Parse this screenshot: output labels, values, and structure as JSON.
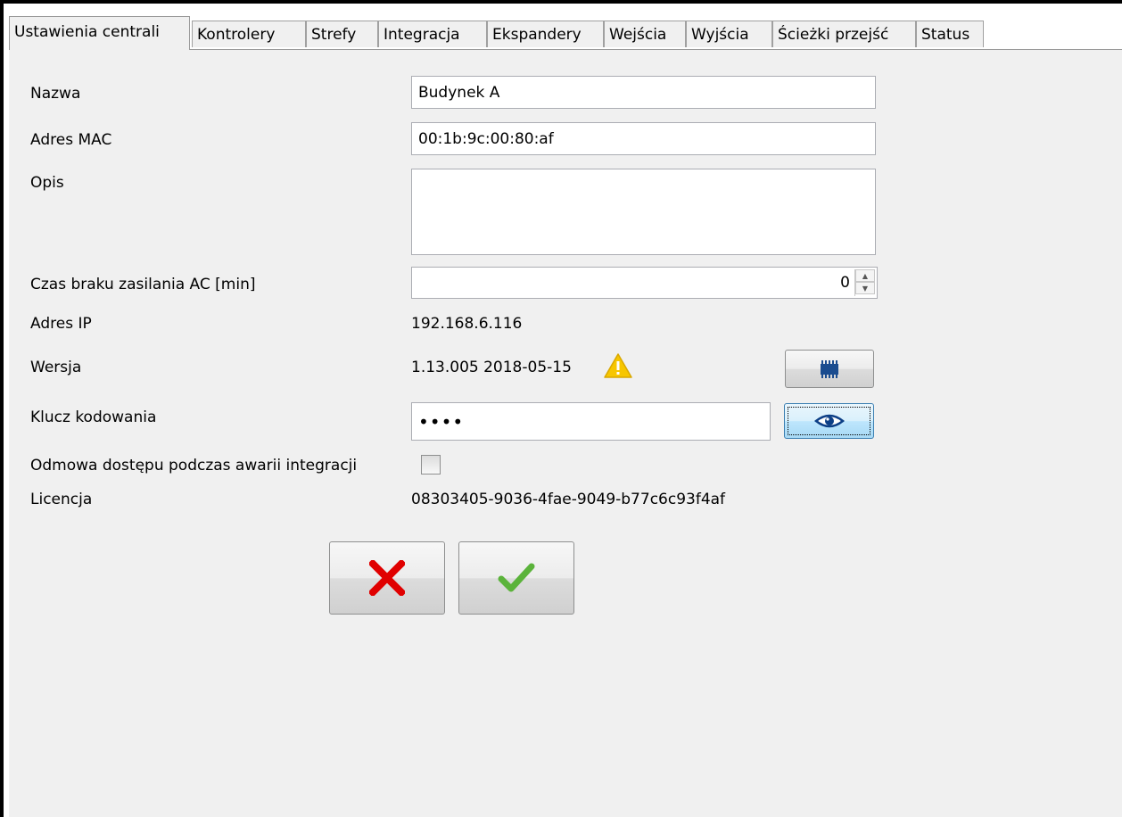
{
  "tabs": [
    "Ustawienia centrali",
    "Kontrolery",
    "Strefy",
    "Integracja",
    "Ekspandery",
    "Wejścia",
    "Wyjścia",
    "Ścieżki przejść",
    "Status"
  ],
  "active_tab": 0,
  "form": {
    "name_label": "Nazwa",
    "name_value": "Budynek A",
    "mac_label": "Adres MAC",
    "mac_value": "00:1b:9c:00:80:af",
    "desc_label": "Opis",
    "desc_value": "",
    "ac_label": "Czas braku zasilania AC [min]",
    "ac_value": "0",
    "ip_label": "Adres IP",
    "ip_value": "192.168.6.116",
    "version_label": "Wersja",
    "version_value": "1.13.005 2018-05-15",
    "key_label": "Klucz kodowania",
    "key_value": "••••",
    "deny_label": "Odmowa dostępu podczas awarii integracji",
    "deny_checked": false,
    "license_label": "Licencja",
    "license_value": "08303405-9036-4fae-9049-b77c6c93f4af"
  },
  "icons": {
    "warning": "warning-icon",
    "firmware": "chip-icon",
    "show_key": "eye-icon",
    "cancel": "cancel-x-icon",
    "confirm": "confirm-check-icon"
  },
  "colors": {
    "warning": "#f7c600",
    "cancel": "#e00000",
    "confirm": "#5bb33b",
    "chip": "#1a4c8f"
  }
}
